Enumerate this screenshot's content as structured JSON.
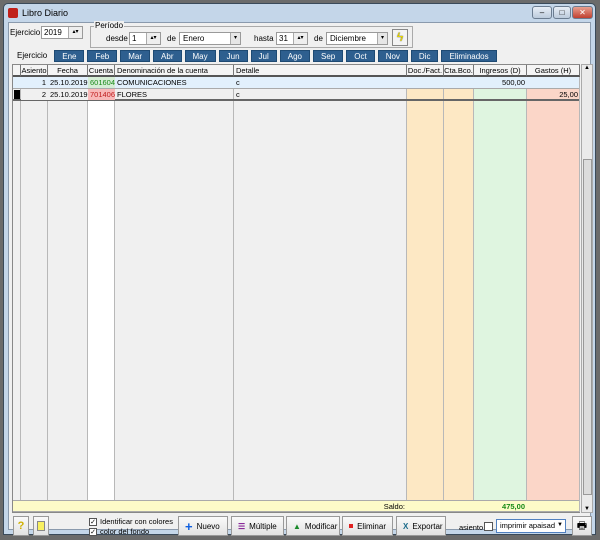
{
  "window": {
    "title": "Libro Diario"
  },
  "filters": {
    "ejercicio_label": "Ejercicio:",
    "ejercicio_value": "2019",
    "periodo_label": "Período",
    "desde_label": "desde",
    "desde_day": "1",
    "de_label": "de",
    "desde_month": "Enero",
    "hasta_label": "hasta",
    "hasta_day": "31",
    "de2_label": "de",
    "hasta_month": "Diciembre"
  },
  "tabs": [
    "Ejercicio",
    "Ene",
    "Feb",
    "Mar",
    "Abr",
    "May",
    "Jun",
    "Jul",
    "Ago",
    "Sep",
    "Oct",
    "Nov",
    "Dic",
    "Eliminados"
  ],
  "columns": [
    "Asiento",
    "Fecha",
    "Cuenta",
    "Denominación de la cuenta",
    "Detalle",
    "Doc./Fact.",
    "Cta.Bco.",
    "Ingresos (D)",
    "Gastos (H)"
  ],
  "rows": [
    {
      "asiento": "1",
      "fecha": "25.10.2019",
      "cuenta": "601604",
      "denominacion": "COMUNICACIONES",
      "detalle": "c",
      "doc": "",
      "ctabco": "",
      "ingresos": "500,00",
      "gastos": ""
    },
    {
      "asiento": "2",
      "fecha": "25.10.2019",
      "cuenta": "701406",
      "denominacion": "FLORES",
      "detalle": "c",
      "doc": "",
      "ctabco": "",
      "ingresos": "",
      "gastos": "25,00"
    }
  ],
  "footer": {
    "saldo_label": "Saldo:",
    "saldo_value": "475,00"
  },
  "options": {
    "identificar": "Identificar con colores",
    "color_fondo": "color del fondo",
    "asiento_label": "asiento",
    "print_mode": "imprimir apaisado"
  },
  "buttons": {
    "nuevo": "Nuevo",
    "multiple": "Múltiple",
    "modificar": "Modificar",
    "eliminar": "Eliminar",
    "exportar": "Exportar"
  },
  "colors": {
    "tab": "#2e5f8f",
    "ingresos": "#dff5e0",
    "gastos": "#fbd6c8",
    "doc": "#fde8c4",
    "saldo": "#178a17"
  }
}
